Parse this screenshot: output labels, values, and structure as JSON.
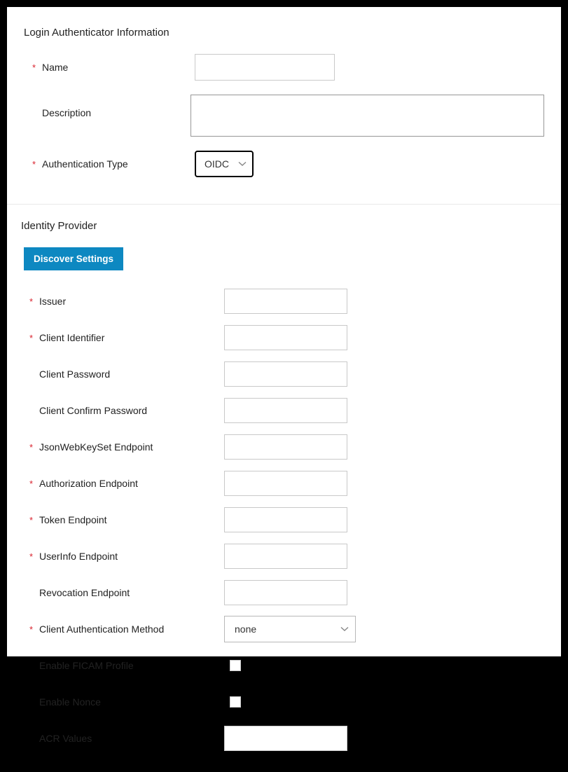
{
  "section1": {
    "title": "Login Authenticator Information",
    "name": {
      "label": "Name",
      "value": ""
    },
    "description": {
      "label": "Description",
      "value": ""
    },
    "authType": {
      "label": "Authentication Type",
      "value": "OIDC"
    }
  },
  "section2": {
    "title": "Identity Provider",
    "discover": "Discover Settings",
    "fields": {
      "issuer": {
        "label": "Issuer",
        "value": "",
        "required": true
      },
      "clientId": {
        "label": "Client Identifier",
        "value": "",
        "required": true
      },
      "clientPwd": {
        "label": "Client Password",
        "value": "",
        "required": false
      },
      "clientPwd2": {
        "label": "Client Confirm Password",
        "value": "",
        "required": false
      },
      "jwks": {
        "label": "JsonWebKeySet Endpoint",
        "value": "",
        "required": true
      },
      "authz": {
        "label": "Authorization Endpoint",
        "value": "",
        "required": true
      },
      "token": {
        "label": "Token Endpoint",
        "value": "",
        "required": true
      },
      "userinfo": {
        "label": "UserInfo Endpoint",
        "value": "",
        "required": true
      },
      "revoke": {
        "label": "Revocation Endpoint",
        "value": "",
        "required": false
      },
      "authMethod": {
        "label": "Client Authentication Method",
        "value": "none",
        "required": true
      },
      "ficam": {
        "label": "Enable FICAM Profile",
        "checked": false,
        "required": false
      },
      "nonce": {
        "label": "Enable Nonce",
        "checked": false,
        "required": false
      },
      "acr": {
        "label": "ACR Values",
        "value": "",
        "required": false
      }
    }
  },
  "asterisk": "*"
}
